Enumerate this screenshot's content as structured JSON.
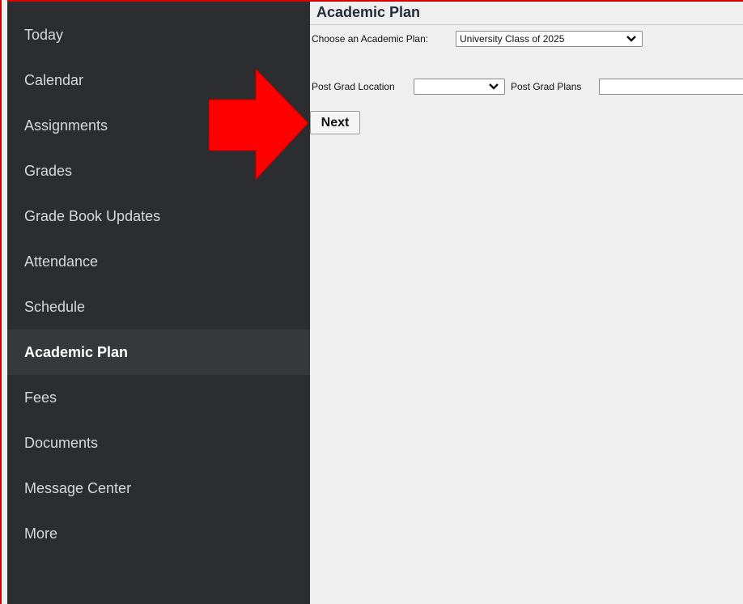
{
  "sidebar": {
    "items": [
      {
        "label": "Today"
      },
      {
        "label": "Calendar"
      },
      {
        "label": "Assignments"
      },
      {
        "label": "Grades"
      },
      {
        "label": "Grade Book Updates"
      },
      {
        "label": "Attendance"
      },
      {
        "label": "Schedule"
      },
      {
        "label": "Academic Plan",
        "active": true
      },
      {
        "label": "Fees"
      },
      {
        "label": "Documents"
      },
      {
        "label": "Message Center"
      },
      {
        "label": "More"
      }
    ]
  },
  "main": {
    "title": "Academic Plan",
    "plan_label": "Choose an Academic Plan:",
    "plan_selected": "University Class of 2025",
    "location_label": "Post Grad Location",
    "location_selected": "",
    "plans_label": "Post Grad Plans",
    "plans_value": "",
    "next_label": "Next"
  },
  "annotation": {
    "arrow_color": "#ff0000",
    "border_color": "#d60000"
  },
  "colors": {
    "sidebar_bg": "#2b2d30",
    "sidebar_active_bg": "#36383b",
    "content_bg": "#efefef"
  },
  "icons": [
    "chevron-down-icon",
    "red-arrow-icon"
  ]
}
